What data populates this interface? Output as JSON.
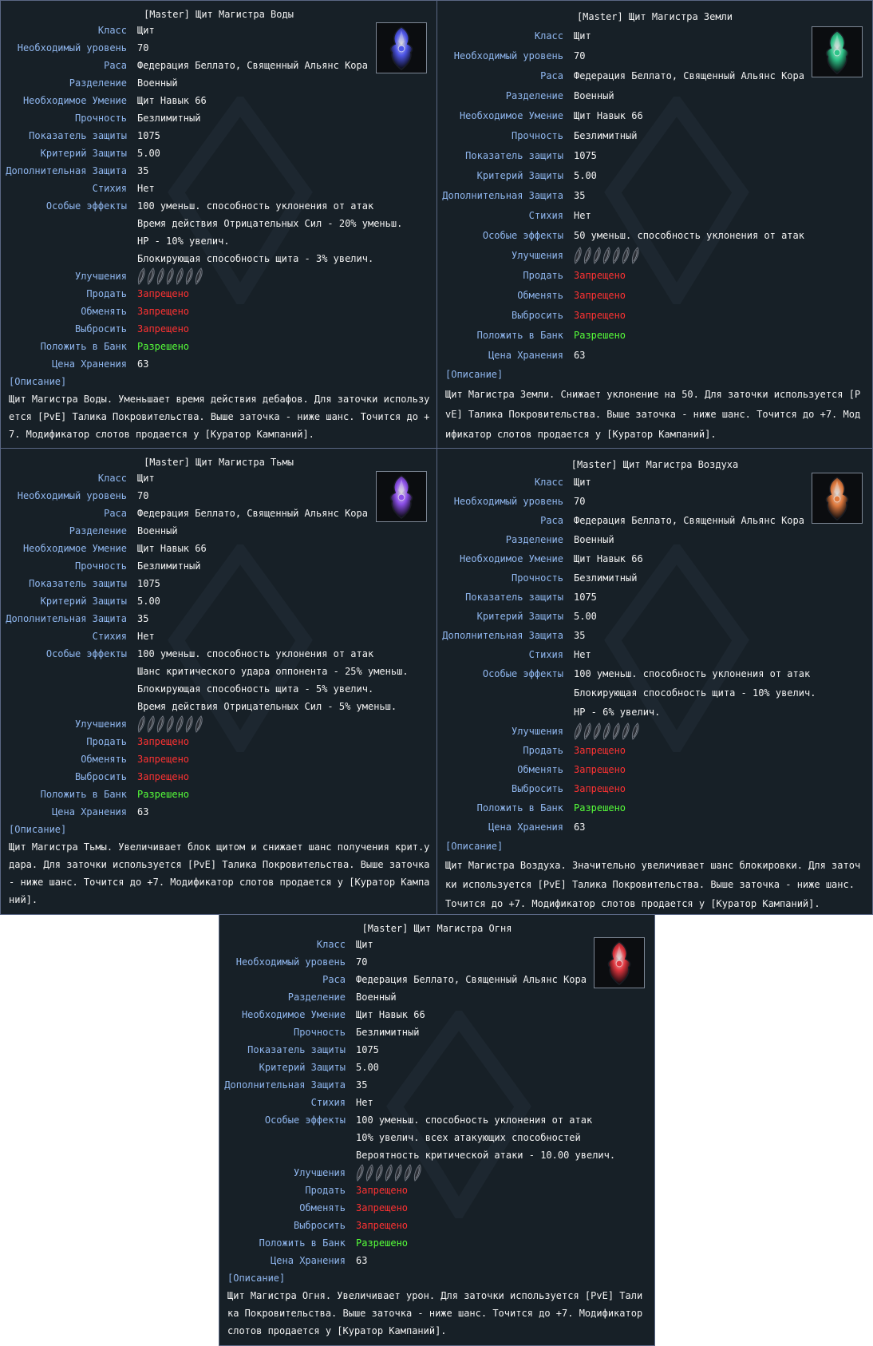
{
  "common": {
    "class_label": "Класс",
    "class_value": "Щит",
    "level_label": "Необходимый уровень",
    "level_value": "70",
    "race_label": "Раса",
    "race_value": "Федерация Беллато, Священный Альянс Кора",
    "category_label": "Разделение",
    "category_value": "Военный",
    "skill_label": "Необходимое Умение",
    "skill_value": "Щит Навык 66",
    "durability_label": "Прочность",
    "durability_value": "Безлимитный",
    "defense_label": "Показатель защиты",
    "defense_value": "1075",
    "def_criteria_label": "Критерий Защиты",
    "def_criteria_value": "5.00",
    "extra_def_label": "Дополнительная Защита",
    "extra_def_value": "35",
    "element_label": "Стихия",
    "element_value": "Нет",
    "effects_label": "Особые эффекты",
    "upgrades_label": "Улучшения",
    "sell_label": "Продать",
    "sell_value": "Запрещено",
    "trade_label": "Обменять",
    "trade_value": "Запрещено",
    "drop_label": "Выбросить",
    "drop_value": "Запрещено",
    "bank_label": "Положить в Банк",
    "bank_value": "Разрешено",
    "storage_label": "Цена Хранения",
    "storage_value": "63",
    "desc_header": "[Описание]",
    "colors": {
      "label": "#8fb6ee",
      "value": "#f2f2f2",
      "forbidden": "#ff3232",
      "allowed": "#56ff3a",
      "panel_bg": "#172027",
      "panel_border": "#5a6784"
    },
    "upgrade_slots": 7
  },
  "items": [
    {
      "title": "[Master] Щит Магистра Воды",
      "icon": "water-shield-icon",
      "gem_color": "#4e56e8",
      "effects": [
        "100 уменьш. способность уклонения от атак",
        "Время действия Отрицательных Сил - 20% уменьш.",
        "HP - 10% увелич.",
        "Блокирующая способность щита - 3% увелич."
      ],
      "description": "Щит Магистра Воды. Уменьшает время действия дебафов. Для заточки используется [PvE] Талика Покровительства. Выше заточка - ниже шанс. Точится до +7. Модификатор слотов продается у [Куратор Кампаний]."
    },
    {
      "title": "[Master] Щит Магистра Земли",
      "icon": "earth-shield-icon",
      "gem_color": "#2fc58a",
      "effects": [
        "50 уменьш. способность уклонения от атак"
      ],
      "description": "Щит Магистра Земли. Снижает уклонение на 50. Для заточки используется [PvE] Талика Покровительства. Выше заточка - ниже шанс. Точится до +7. Модификатор слотов продается у [Куратор Кампаний]."
    },
    {
      "title": "[Master] Щит Магистра Тьмы",
      "icon": "dark-shield-icon",
      "gem_color": "#8c4fe8",
      "effects": [
        "100 уменьш. способность уклонения от атак",
        "Шанс критического удара оппонента - 25% уменьш.",
        "Блокирующая способность щита - 5% увелич.",
        "Время действия Отрицательных Сил - 5% уменьш."
      ],
      "description": "Щит Магистра Тьмы. Увеличивает блок щитом и снижает шанс получения крит.удара. Для заточки используется [PvE] Талика Покровительства. Выше заточка - ниже шанс. Точится до +7. Модификатор слотов продается у [Куратор Кампаний]."
    },
    {
      "title": "[Master] Щит Магистра Воздуха",
      "icon": "air-shield-icon",
      "gem_color": "#e07a3e",
      "effects": [
        "100 уменьш. способность уклонения от атак",
        "Блокирующая способность щита - 10% увелич.",
        "HP - 6% увелич."
      ],
      "description": "Щит Магистра Воздуха. Значительно увеличивает шанс блокировки. Для заточки используется [PvE] Талика Покровительства. Выше заточка - ниже шанс. Точится до +7. Модификатор слотов продается у [Куратор Кампаний]."
    },
    {
      "title": "[Master] Щит Магистра Огня",
      "icon": "fire-shield-icon",
      "gem_color": "#e0353e",
      "effects": [
        "100 уменьш. способность уклонения от атак",
        "10% увелич. всех атакующих способностей",
        "Вероятность критической атаки - 10.00 увелич."
      ],
      "description": "Щит Магистра Огня. Увеличивает урон. Для заточки используется [PvE] Талика Покровительства. Выше заточка - ниже шанс. Точится до +7. Модификатор слотов продается у [Куратор Кампаний]."
    }
  ]
}
